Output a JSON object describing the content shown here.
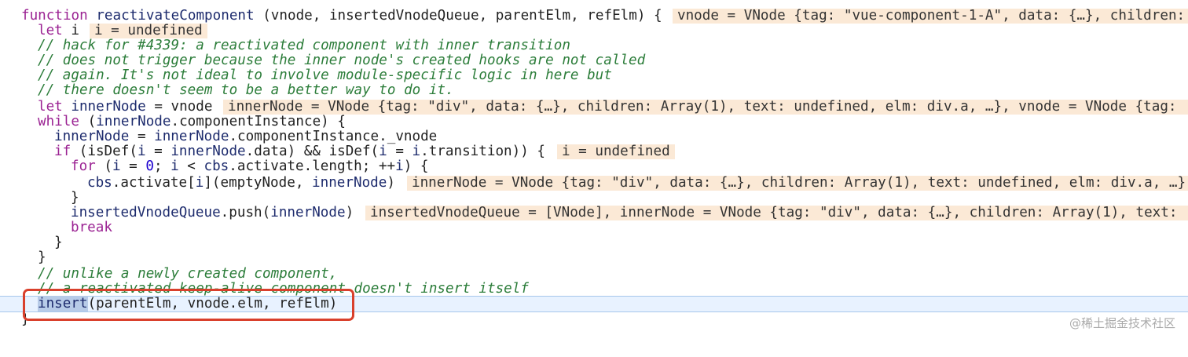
{
  "lines": [
    {
      "code": "function reactivateComponent (vnode, insertedVnodeQueue, parentElm, refElm) {",
      "eval": "vnode = VNode {tag: \"vue-component-1-A\", data: {…}, children:"
    },
    {
      "code": "let i",
      "eval": "i = undefined"
    },
    {
      "code": "// hack for #4339: a reactivated component with inner transition"
    },
    {
      "code": "// does not trigger because the inner node's created hooks are not called"
    },
    {
      "code": "// again. It's not ideal to involve module-specific logic in here but"
    },
    {
      "code": "// there doesn't seem to be a better way to do it."
    },
    {
      "code": "let innerNode = vnode",
      "eval": "innerNode = VNode {tag: \"div\", data: {…}, children: Array(1), text: undefined, elm: div.a, …}, vnode = VNode {tag:"
    },
    {
      "code": "while (innerNode.componentInstance) {"
    },
    {
      "code": "innerNode = innerNode.componentInstance._vnode"
    },
    {
      "code": "if (isDef(i = innerNode.data) && isDef(i = i.transition)) {",
      "eval": "i = undefined"
    },
    {
      "code": "for (i = 0; i < cbs.activate.length; ++i) {"
    },
    {
      "code": "cbs.activate[i](emptyNode, innerNode)",
      "eval": "innerNode = VNode {tag: \"div\", data: {…}, children: Array(1), text: undefined, elm: div.a, …}"
    },
    {
      "code": "}"
    },
    {
      "code": "insertedVnodeQueue.push(innerNode)",
      "eval": "insertedVnodeQueue = [VNode], innerNode = VNode {tag: \"div\", data: {…}, children: Array(1), text:"
    },
    {
      "code": "break"
    },
    {
      "code": "}"
    },
    {
      "code": "}"
    },
    {
      "code": "// unlike a newly created component,"
    },
    {
      "code": "// a reactivated keep-alive component doesn't insert itself"
    },
    {
      "code": "insert(parentElm, vnode.elm, refElm)"
    },
    {
      "code": "}"
    }
  ],
  "watermark": "@稀土掘金技术社区",
  "colors": {
    "highlight_line": "#e8f2ff",
    "eval_bg": "#fbe9d6",
    "red_box": "#d9402c",
    "comment": "#2c7d3a"
  }
}
